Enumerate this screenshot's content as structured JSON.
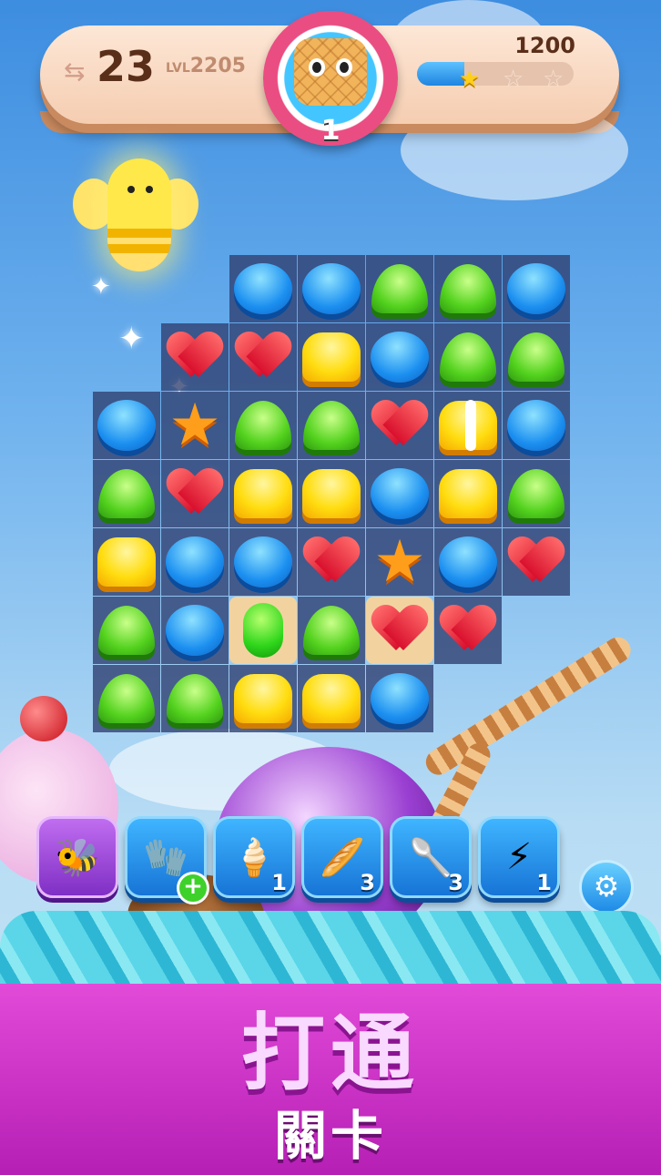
{
  "hud": {
    "moves": "23",
    "moves_icon": "swap-arrows-icon",
    "level_prefix": "LVL",
    "level_number": "2205",
    "score": "1200",
    "progress_fraction": 0.3,
    "stars_earned": 1,
    "stars_total": 3,
    "target_count": "1",
    "target_icon": "waffle-creature-icon"
  },
  "board": {
    "rows": 7,
    "cols": 7,
    "cells": [
      [
        "",
        "",
        "blue",
        "blue",
        "green",
        "green",
        "blue"
      ],
      [
        "",
        "red",
        "red",
        "yellow",
        "blue",
        "green",
        "green"
      ],
      [
        "blue",
        "orange",
        "green",
        "green",
        "red",
        "yellow-striped",
        "blue"
      ],
      [
        "green",
        "red",
        "yellow",
        "yellow",
        "blue",
        "yellow",
        "green"
      ],
      [
        "yellow",
        "blue",
        "blue",
        "red",
        "orange",
        "blue",
        "red"
      ],
      [
        "green",
        "blue",
        "cocoon-waffle",
        "green",
        "red-waffle",
        "red",
        ""
      ],
      [
        "green",
        "green",
        "yellow",
        "yellow",
        "blue",
        "",
        ""
      ]
    ]
  },
  "boosters": [
    {
      "icon": "bee-swarm-icon",
      "count": "",
      "active": true,
      "plus": false
    },
    {
      "icon": "oven-mitt-icon",
      "count": "",
      "active": false,
      "plus": true
    },
    {
      "icon": "piping-bag-icon",
      "count": "1",
      "active": false,
      "plus": false
    },
    {
      "icon": "rolling-pin-icon",
      "count": "3",
      "active": false,
      "plus": false
    },
    {
      "icon": "spoon-icon",
      "count": "3",
      "active": false,
      "plus": false
    },
    {
      "icon": "lightning-balloon-icon",
      "count": "1",
      "active": false,
      "plus": false
    }
  ],
  "settings_icon": "gear-icon",
  "banner": {
    "line1": "打通",
    "line2": "關卡"
  },
  "colors": {
    "banner": "#d536cf",
    "rope": "#41c8de",
    "board_cell": "#2e3e6e"
  }
}
